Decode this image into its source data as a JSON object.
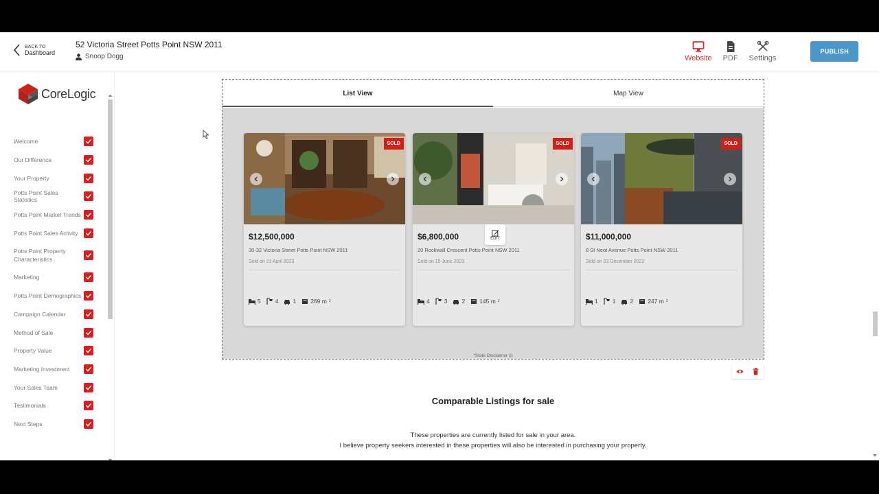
{
  "header": {
    "back_small": "BACK TO",
    "back_label": "Dashboard",
    "address": "52 Victoria Street Potts Point NSW 2011",
    "user": "Snoop Dogg",
    "actions": [
      {
        "label": "Website",
        "icon": "monitor-icon"
      },
      {
        "label": "PDF",
        "icon": "document-icon"
      },
      {
        "label": "Settings",
        "icon": "tools-icon"
      }
    ],
    "publish": "PUBLISH"
  },
  "brand": {
    "logo_text": "CoreLogic",
    "accent": "#d0201a",
    "publish_color": "#4a98c9"
  },
  "sidebar": {
    "items": [
      {
        "label": "Welcome"
      },
      {
        "label": "Our Difference"
      },
      {
        "label": "Your Property"
      },
      {
        "label": "Potts Point Sales Statistics"
      },
      {
        "label": "Potts Point Market Trends"
      },
      {
        "label": "Potts Point Sales Activity"
      },
      {
        "label": "Potts Point Property Characteristics"
      },
      {
        "label": "Marketing"
      },
      {
        "label": "Potts Point Demographics"
      },
      {
        "label": "Campaign Calendar"
      },
      {
        "label": "Method of Sale"
      },
      {
        "label": "Property Value"
      },
      {
        "label": "Marketing Investment"
      },
      {
        "label": "Your Sales Team"
      },
      {
        "label": "Testimonials"
      },
      {
        "label": "Next Steps"
      }
    ]
  },
  "tabs": [
    {
      "label": "List View"
    },
    {
      "label": "Map View"
    }
  ],
  "cards": [
    {
      "badge": "SOLD",
      "price": "$12,500,000",
      "address": "30-32 Victoria Street Potts Point NSW 2011",
      "sold": "Sold on 21 April 2023",
      "beds": "5",
      "baths": "4",
      "cars": "1",
      "area": "269 m"
    },
    {
      "badge": "SOLD",
      "price": "$6,800,000",
      "address": "20 Rockwall Crescent Potts Point NSW 2011",
      "sold": "Sold on 15 June 2023",
      "beds": "4",
      "baths": "3",
      "cars": "2",
      "area": "145 m"
    },
    {
      "badge": "SOLD",
      "price": "$11,000,000",
      "address": "8 St Neot Avenue Potts Point NSW 2011",
      "sold": "Sold on 23 December 2022",
      "beds": "1",
      "baths": "1",
      "cars": "2",
      "area": "247 m"
    }
  ],
  "edit_label": "EDIT",
  "disclaimer": "*State Disclaimer (i)",
  "next_section": {
    "heading": "Comparable Listings for sale",
    "line1": "These properties are currently listed for sale in your area.",
    "line2": "I believe property seekers interested in these properties will also be interested in purchasing your property."
  }
}
